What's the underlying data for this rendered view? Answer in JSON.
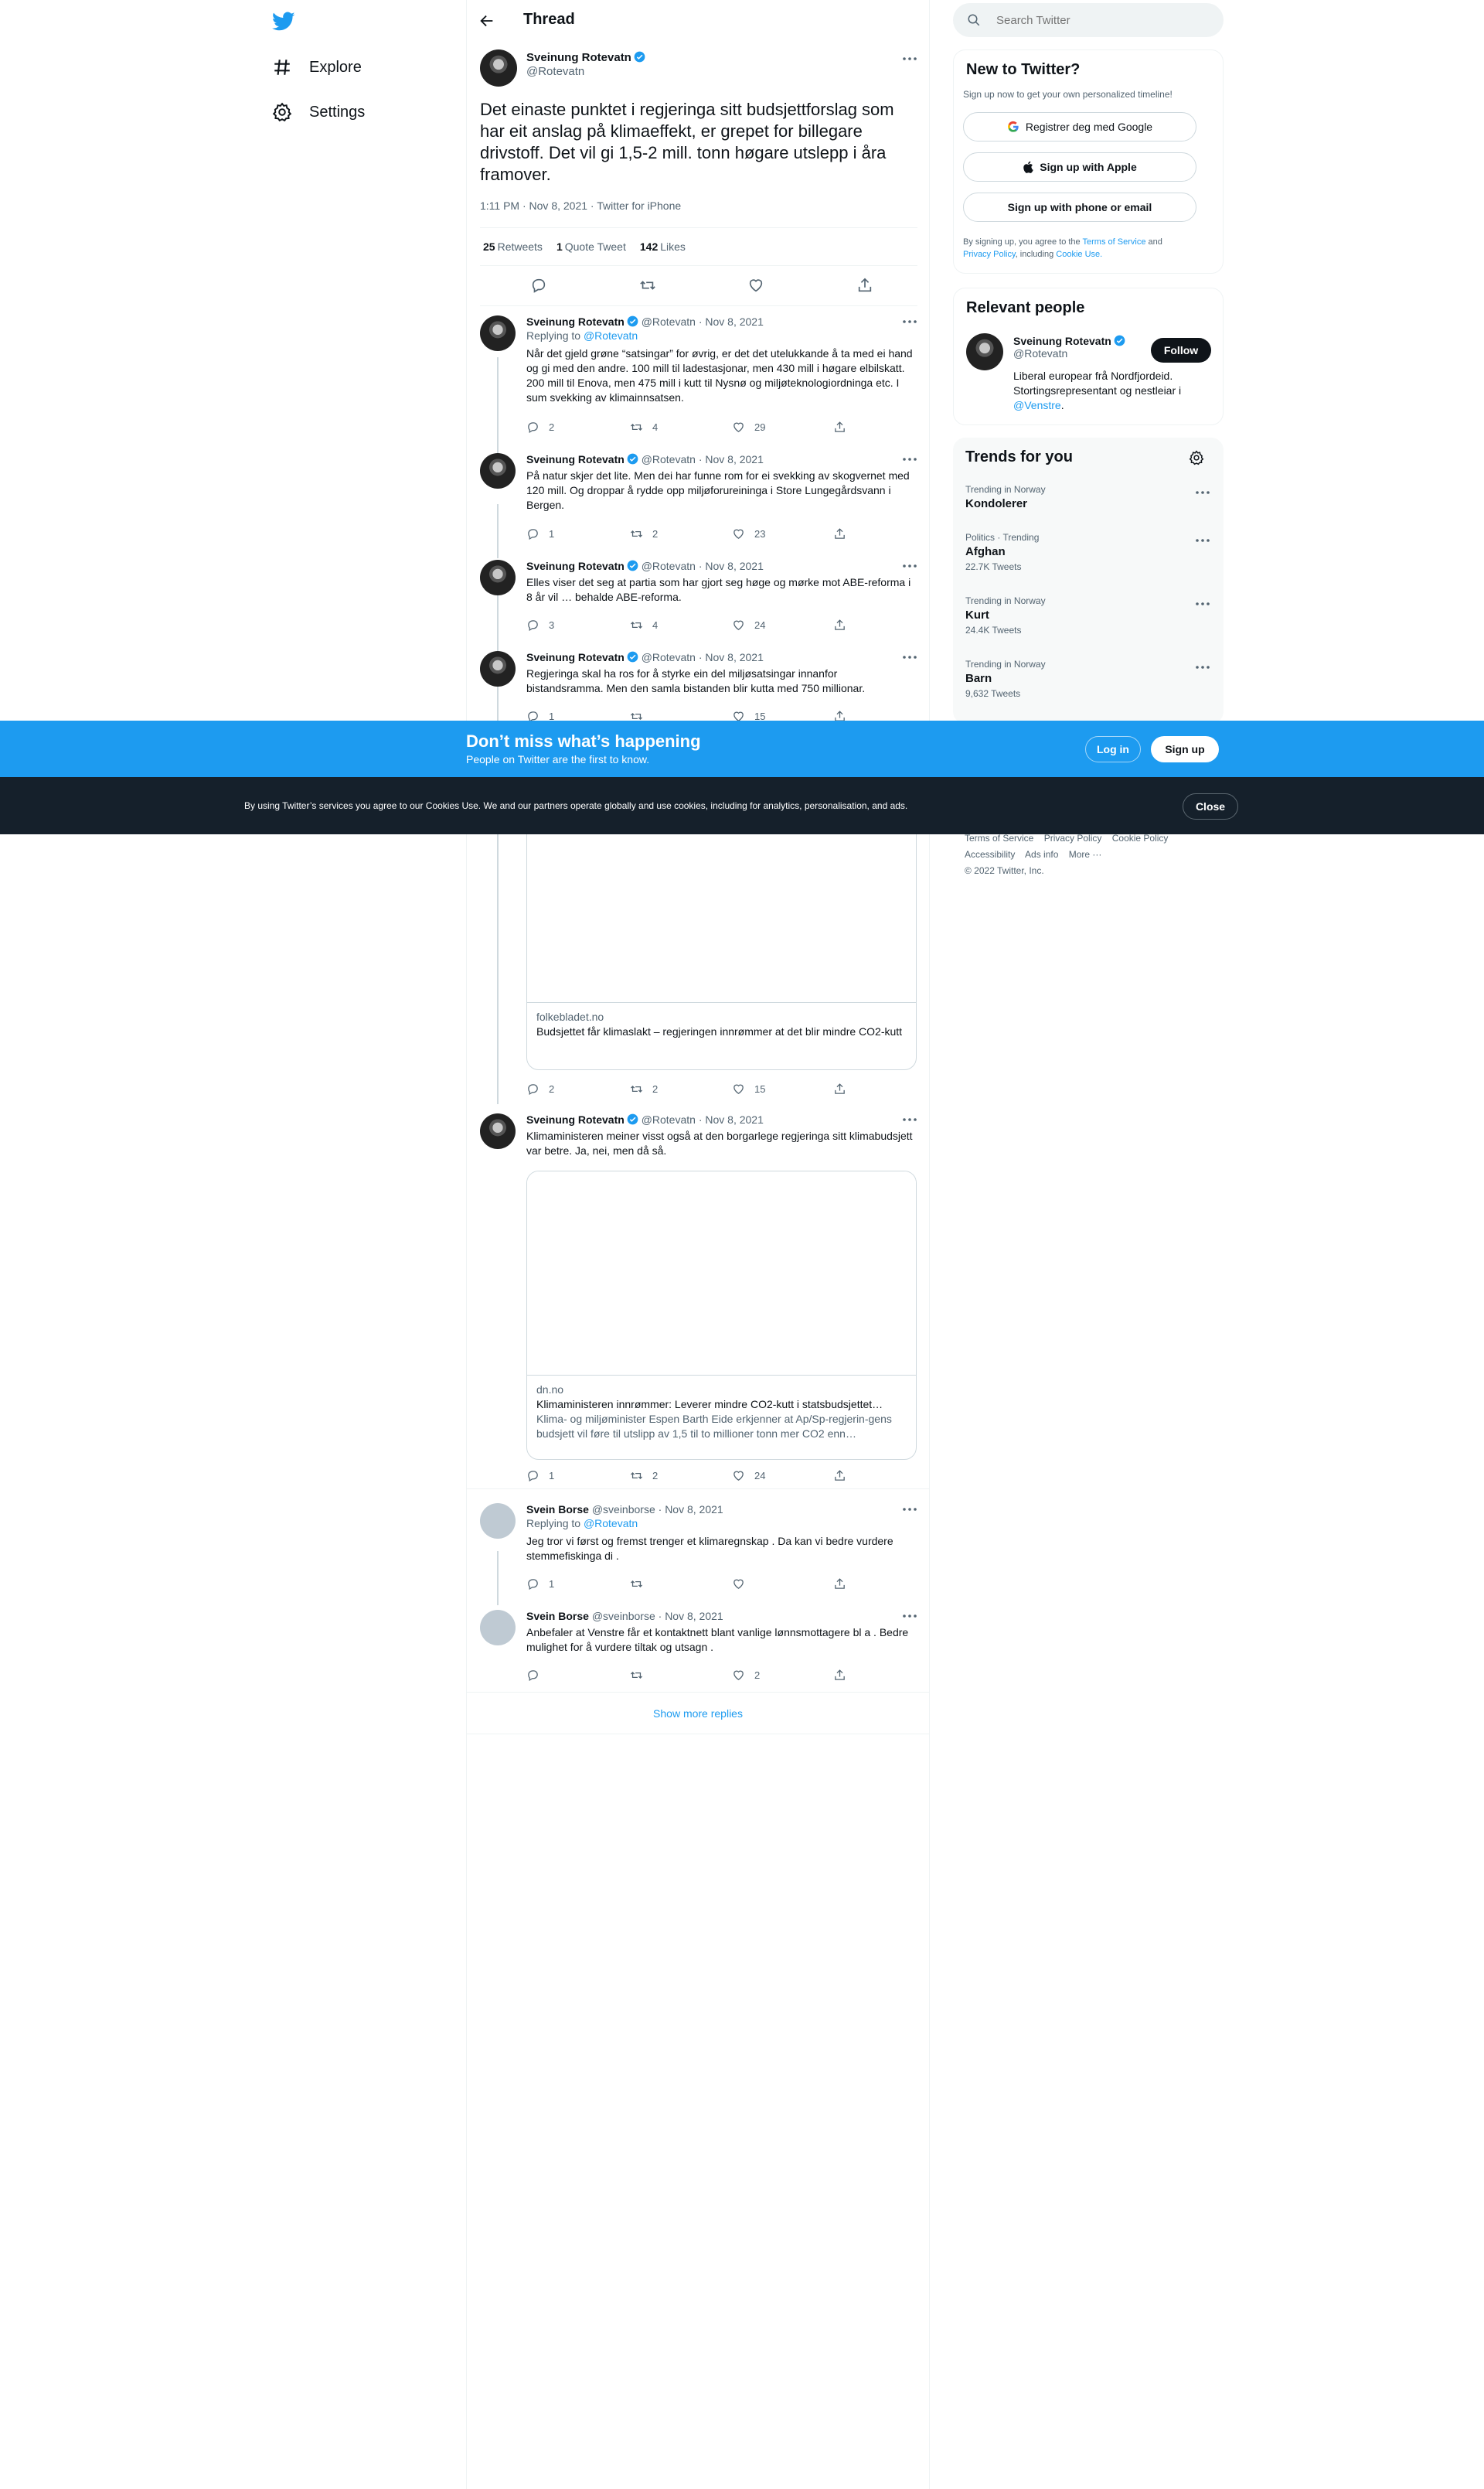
{
  "nav": {
    "items": [
      {
        "label": "Explore",
        "icon": "hashtag-icon"
      },
      {
        "label": "Settings",
        "icon": "gear-icon"
      }
    ]
  },
  "header": {
    "title": "Thread"
  },
  "main_tweet": {
    "name": "Sveinung Rotevatn",
    "handle": "@Rotevatn",
    "text": "Det einaste punktet i regjeringa sitt budsjettforslag som har eit anslag på klimaeffekt, er grepet for billegare drivstoff. Det vil gi 1,5-2 mill. tonn høgare utslepp i åra framover.",
    "meta": "1:11 PM · Nov 8, 2021 · Twitter for iPhone",
    "retweets": "25",
    "retweets_label": "Retweets",
    "quotes": "1",
    "quotes_label": "Quote Tweet",
    "likes": "142",
    "likes_label": "Likes"
  },
  "replies": [
    {
      "name": "Sveinung Rotevatn",
      "handle": "@Rotevatn",
      "date": "· Nov 8, 2021",
      "replying_label": "Replying to",
      "replying_to": "@Rotevatn",
      "text": "Når det gjeld grøne “satsingar” for øvrig, er det det utelukkande å ta med ei hand og gi med den andre. 100 mill til ladestasjonar, men 430 mill i høgare elbilskatt. 200 mill til Enova, men 475 mill i kutt til Nysnø og miljøteknologiordninga etc. I sum svekking av klimainnsatsen.",
      "replies": "2",
      "retweets": "4",
      "likes": "29"
    },
    {
      "name": "Sveinung Rotevatn",
      "handle": "@Rotevatn",
      "date": "· Nov 8, 2021",
      "text": "På natur skjer det lite. Men dei har funne rom for ei svekking av skogvernet med 120 mill. Og droppar å rydde opp miljøforureininga i Store Lungegårdsvann i Bergen.",
      "replies": "1",
      "retweets": "2",
      "likes": "23"
    },
    {
      "name": "Sveinung Rotevatn",
      "handle": "@Rotevatn",
      "date": "· Nov 8, 2021",
      "text": "Elles viser det seg at partia som har gjort seg høge og mørke mot ABE-reforma i 8 år vil … behalde ABE-reforma.",
      "replies": "3",
      "retweets": "4",
      "likes": "24"
    },
    {
      "name": "Sveinung Rotevatn",
      "handle": "@Rotevatn",
      "date": "· Nov 8, 2021",
      "text": "Regjeringa skal ha ros for å styrke ein del miljøsatsingar innanfor bistandsramma. Men den samla bistanden blir kutta med 750 millionar.",
      "replies": "1",
      "retweets": "",
      "likes": "15"
    }
  ],
  "card1": {
    "domain": "folkebladet.no",
    "title": "Budsjettet får klimaslakt – regjeringen innrømmer at det blir mindre CO2-kutt",
    "replies": "2",
    "retweets": "2",
    "likes": "15"
  },
  "tweet6": {
    "name": "Sveinung Rotevatn",
    "handle": "@Rotevatn",
    "date": "· Nov 8, 2021",
    "text": "Klimaministeren meiner visst også at den borgarlege regjeringa sitt klimabudsjett var betre. Ja, nei, men då så.",
    "card_domain": "dn.no",
    "card_title": "Klimaministeren innrømmer: Leverer mindre CO2-kutt i statsbudsjettet…",
    "card_desc": "Klima- og miljøminister Espen Barth Eide erkjenner at Ap/Sp-regjerin-gens budsjett vil føre til utslipp av 1,5 til to millioner tonn mer CO2 enn…",
    "replies": "1",
    "retweets": "2",
    "likes": "24"
  },
  "tweet7": {
    "name": "Svein Borse",
    "handle": "@sveinborse",
    "date": "· Nov 8, 2021",
    "replying_label": "Replying to",
    "replying_to": "@Rotevatn",
    "text": "Jeg tror vi først og fremst trenger et klimaregnskap . Da kan vi bedre vurdere stemmefiskinga di .",
    "replies": "1",
    "retweets": "",
    "likes": ""
  },
  "tweet8": {
    "name": "Svein Borse",
    "handle": "@sveinborse",
    "date": "· Nov 8, 2021",
    "text": "Anbefaler at Venstre får et kontaktnett blant vanlige lønnsmottagere bl a . Bedre mulighet for å vurdere tiltak og utsagn .",
    "replies": "",
    "retweets": "",
    "likes": "2"
  },
  "show_more": "Show more replies",
  "search": {
    "placeholder": "Search Twitter"
  },
  "new_to_twitter": {
    "title": "New to Twitter?",
    "subtitle": "Sign up now to get your own personalized timeline!",
    "google_label": "Registrer deg med Google",
    "apple_label": "Sign up with Apple",
    "phone_label": "Sign up with phone or email",
    "terms_pre": "By signing up, you agree to the",
    "terms_link": "Terms of Service",
    "terms_and": "and",
    "privacy_link": "Privacy Policy",
    "terms_including": ", including",
    "cookie_link": "Cookie Use."
  },
  "relevant_people": {
    "title": "Relevant people",
    "name": "Sveinung Rotevatn",
    "handle": "@Rotevatn",
    "follow_label": "Follow",
    "bio": "Liberal europear frå Nordfjordeid. Stortingsrepresentant og nestleiar i",
    "bio_link": "@Venstre",
    "bio_end": "."
  },
  "trends": {
    "title": "Trends for you",
    "items": [
      {
        "category": "Trending in Norway",
        "name": "Kondolerer",
        "count": ""
      },
      {
        "category": "Politics · Trending",
        "name": "Afghan",
        "count": "22.7K Tweets"
      },
      {
        "category": "Trending in Norway",
        "name": "Kurt",
        "count": "24.4K Tweets"
      },
      {
        "category": "Trending in Norway",
        "name": "Barn",
        "count": "9,632 Tweets"
      }
    ]
  },
  "footer": {
    "terms": "Terms of Service",
    "privacy": "Privacy Policy",
    "cookie": "Cookie Policy",
    "accessibility": "Accessibility",
    "ads": "Ads info",
    "more": "More ···",
    "copyright": "© 2022 Twitter, Inc."
  },
  "banner": {
    "headline": "Don’t miss what’s happening",
    "sub": "People on Twitter are the first to know.",
    "login_label": "Log in",
    "signup_label": "Sign up"
  },
  "cookie": {
    "text": "By using Twitter’s services you agree to our Cookies Use. We and our partners operate globally and use cookies, including for analytics, personalisation, and ads.",
    "close_label": "Close"
  },
  "colors": {
    "accent": "#1d9bf0",
    "dark": "#0f1419",
    "cookie_bg": "#15202b"
  }
}
